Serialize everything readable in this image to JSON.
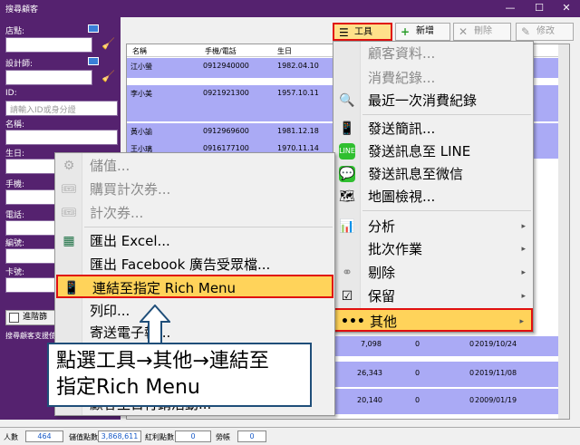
{
  "window": {
    "title": "搜尋顧客",
    "minimize": "—",
    "maximize": "☐",
    "close": "✕"
  },
  "left": {
    "store_label": "店點:",
    "designer_label": "設計師:",
    "id_label": "ID:",
    "id_placeholder": "請輸入ID或身分證",
    "name_label": "名稱:",
    "birthday_label": "生日:",
    "mobile_label": "手機:",
    "phone_label": "電話:",
    "number_label": "編號:",
    "card_label": "卡號:",
    "advanced_button": "進階篩",
    "note": "搜尋顧客支援使用"
  },
  "toolbar": {
    "tools": "工具",
    "add": "新增",
    "delete": "刪除",
    "edit": "修改"
  },
  "grid": {
    "columns": [
      "名稱",
      "手機/電話",
      "生日"
    ],
    "rows": [
      [
        "江小螢",
        "0912940000",
        "1982.04.10"
      ],
      [
        "李小美",
        "0921921300",
        "1957.10.11"
      ],
      [
        "黃小諭",
        "0912969600",
        "1981.12.18"
      ],
      [
        "王小璃",
        "0916177100",
        "1970.11.14"
      ]
    ],
    "bottom_rows": [
      [
        "7,098",
        "0",
        "0",
        "2019/10/24"
      ],
      [
        "26,343",
        "0",
        "0",
        "2019/11/08"
      ],
      [
        "20,140",
        "0",
        "0",
        "2009/01/19"
      ]
    ]
  },
  "status": {
    "count_label": "人數",
    "count": "464",
    "points_label": "儲值點數",
    "points": "3,868,611",
    "bonus_label": "紅利點數",
    "bonus": "0",
    "visits_label": "勞帳",
    "visits": "0"
  },
  "tools_menu": [
    {
      "label": "顧客資料...",
      "disabled": true
    },
    {
      "label": "消費紀錄...",
      "disabled": true
    },
    {
      "label": "最近一次消費紀錄",
      "disabled": false
    },
    {
      "label": "發送簡訊...",
      "disabled": false
    },
    {
      "label": "發送訊息至 LINE",
      "disabled": false
    },
    {
      "label": "發送訊息至微信",
      "disabled": false
    },
    {
      "label": "地圖檢視...",
      "disabled": false
    },
    {
      "label": "分析",
      "disabled": false
    },
    {
      "label": "批次作業",
      "disabled": false
    },
    {
      "label": "剔除",
      "disabled": false
    },
    {
      "label": "保留",
      "disabled": false
    },
    {
      "label": "其他",
      "disabled": false
    }
  ],
  "other_menu": [
    {
      "label": "儲值...",
      "disabled": true
    },
    {
      "label": "購買計次券...",
      "disabled": true
    },
    {
      "label": "計次券...",
      "disabled": true
    },
    {
      "label": "匯出 Excel...",
      "disabled": false
    },
    {
      "label": "匯出 Facebook 廣告受眾檔...",
      "disabled": false
    },
    {
      "label": "連結至指定 Rich Menu",
      "disabled": false
    },
    {
      "label": "列印...",
      "disabled": false
    },
    {
      "label": "寄送電子報...",
      "disabled": false
    },
    {
      "label": "顧客生日行銷活動...",
      "disabled": false
    }
  ],
  "callout": {
    "line1": "點選工具→其他→連結至",
    "line2": "指定Rich Menu"
  },
  "colors": {
    "accent": "#55226f",
    "highlight": "#e01010",
    "row": "#aaaaf5"
  }
}
